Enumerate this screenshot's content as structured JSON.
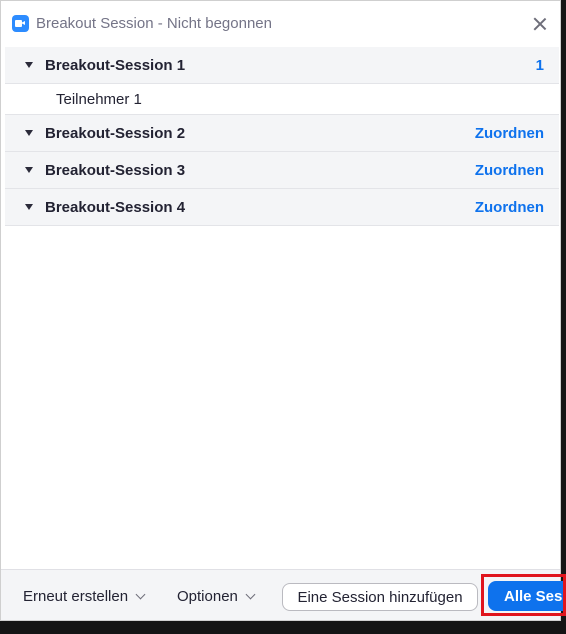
{
  "window": {
    "title": "Breakout Session - Nicht begonnen"
  },
  "sessions": [
    {
      "name": "Breakout-Session 1",
      "action": "1",
      "expanded": true,
      "participants": [
        "Teilnehmer 1"
      ]
    },
    {
      "name": "Breakout-Session 2",
      "action": "Zuordnen",
      "expanded": false,
      "participants": []
    },
    {
      "name": "Breakout-Session 3",
      "action": "Zuordnen",
      "expanded": false,
      "participants": []
    },
    {
      "name": "Breakout-Session 4",
      "action": "Zuordnen",
      "expanded": false,
      "participants": []
    }
  ],
  "footer": {
    "recreate_label": "Erneut erstellen",
    "options_label": "Optionen",
    "add_session_label": "Eine Session hinzufügen",
    "open_all_label": "Alle Ses"
  },
  "colors": {
    "accent": "#0e72ed",
    "highlight_border": "#e0151d"
  }
}
